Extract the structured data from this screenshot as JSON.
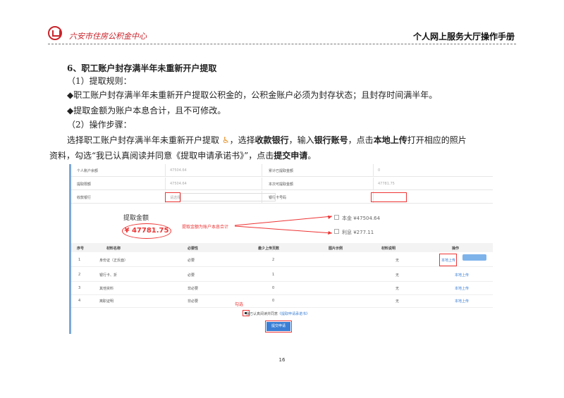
{
  "header": {
    "org": "六安市住房公积金中心",
    "manual": "个人网上服务大厅操作手册"
  },
  "section": {
    "heading": "6、职工账户封存满半年未重新开户提取",
    "rules_title": "（1）提取规则：",
    "rule1": "◆职工账户封存满半年未重新开户提取公积金的，公积金账户必须为封存状态；且封存时间满半年。",
    "rule2": "◆提取金额为账户本息合计，且不可修改。",
    "steps_title": "（2）操作步骤：",
    "step_a": "选择职工账户封存满半年未重新开户提取",
    "step_icon": "wheelchair-icon",
    "step_b": "，选择",
    "step_bold1": "收款银行",
    "step_c": "，输入",
    "step_bold2": "银行账号",
    "step_d": "，点击",
    "step_bold3": "本地上传",
    "step_e": "打开相应的照片",
    "step2_a": "资料，勾选“我已认真阅读并同意《提取申请承诺书》”，点击",
    "step2_bold": "提交申请",
    "step2_b": "。"
  },
  "screenshot": {
    "rows": [
      {
        "l1": "个人账户余额",
        "v1": "47504.64",
        "l2": "累计已提取金额",
        "v2": "0"
      },
      {
        "l1": "提取限额",
        "v1": "47504.64",
        "l2": "本次可提取金额",
        "v2": "47781.75"
      },
      {
        "l1": "收款银行",
        "v1": "请选择",
        "l2": "银行卡号码",
        "v2": ""
      }
    ],
    "amount_label": "提取金额",
    "amount": "¥ 47781.75",
    "annotation": "提取金额为账户本息合计",
    "principal": "本金 ¥47504.64",
    "interest": "利息 ¥277.11",
    "columns": [
      "序号",
      "材料名称",
      "必要性",
      "最少上传页数",
      "图片示例",
      "材料说明",
      "操作"
    ],
    "table": [
      {
        "no": "1",
        "name": "身份证（正反面）",
        "req": "必要",
        "pages": "2",
        "desc": "无",
        "op": "本地上传"
      },
      {
        "no": "2",
        "name": "银行卡、折",
        "req": "必要",
        "pages": "1",
        "desc": "无",
        "op": "本地上传"
      },
      {
        "no": "3",
        "name": "其他资料",
        "req": "非必要",
        "pages": "0",
        "desc": "无",
        "op": "本地上传"
      },
      {
        "no": "4",
        "name": "离职证明",
        "req": "非必要",
        "pages": "0",
        "desc": "无",
        "op": "本地上传"
      }
    ],
    "check_note": "勾选",
    "agree_text": "我已认真阅读并同意",
    "agree_link": "《提取申请承诺书》",
    "submit": "提交申请"
  },
  "page_number": "16"
}
